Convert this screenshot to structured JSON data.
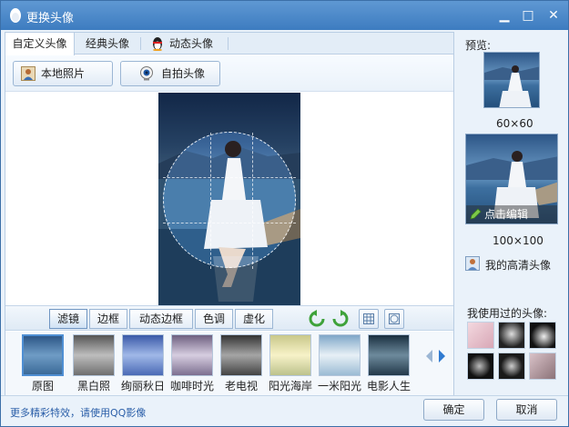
{
  "window": {
    "title": "更换头像",
    "minimize_glyph": "▁",
    "maximize_glyph": "□",
    "close_glyph": "✕"
  },
  "tabs": [
    {
      "label": "自定义头像",
      "active": true
    },
    {
      "label": "经典头像",
      "active": false
    },
    {
      "label": "动态头像",
      "active": false
    }
  ],
  "toolbar": {
    "local_photo_label": "本地照片",
    "selfie_label": "自拍头像"
  },
  "filter_tabs": [
    {
      "label": "滤镜",
      "active": true
    },
    {
      "label": "边框",
      "active": false
    },
    {
      "label": "动态边框",
      "active": false
    },
    {
      "label": "色调",
      "active": false
    },
    {
      "label": "虚化",
      "active": false
    }
  ],
  "filters": [
    {
      "label": "原图",
      "selected": true,
      "tone": "#3d6ea3"
    },
    {
      "label": "黑白照",
      "selected": false,
      "tone": "#8a8a8a"
    },
    {
      "label": "绚丽秋日",
      "selected": false,
      "tone": "#5d7fbf"
    },
    {
      "label": "咖啡时光",
      "selected": false,
      "tone": "#8a7f9c"
    },
    {
      "label": "老电视",
      "selected": false,
      "tone": "#5e5e5e"
    },
    {
      "label": "阳光海岸",
      "selected": false,
      "tone": "#d5d49a"
    },
    {
      "label": "一米阳光",
      "selected": false,
      "tone": "#8fb7d2"
    },
    {
      "label": "电影人生",
      "selected": false,
      "tone": "#2e4a5e"
    }
  ],
  "footer": {
    "more_effects_link": "更多精彩特效，请使用QQ影像",
    "ok_label": "确定",
    "cancel_label": "取消"
  },
  "right_panel": {
    "preview_label": "预览:",
    "size_small": "60×60",
    "size_large": "100×100",
    "edit_label": "点击编辑",
    "hd_avatar_label": "我的高清头像",
    "used_label": "我使用过的头像:"
  },
  "colors": {
    "title_bar": "#4a87c8",
    "accent": "#4f8fd3",
    "link": "#2a5ea8"
  }
}
